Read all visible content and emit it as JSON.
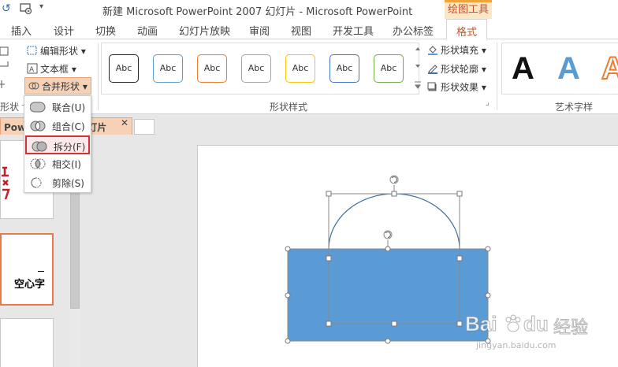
{
  "window": {
    "title": "新建 Microsoft PowerPoint 2007 幻灯片 - Microsoft PowerPoint",
    "context_tab_group": "绘图工具"
  },
  "tabs": [
    {
      "label": "插入"
    },
    {
      "label": "设计"
    },
    {
      "label": "切换"
    },
    {
      "label": "动画"
    },
    {
      "label": "幻灯片放映"
    },
    {
      "label": "审阅"
    },
    {
      "label": "视图"
    },
    {
      "label": "开发工具"
    },
    {
      "label": "办公标签"
    },
    {
      "label": "格式",
      "active": true
    }
  ],
  "ribbon": {
    "insert_shapes": {
      "edit_shape": "编辑形状",
      "text_box": "文本框",
      "merge_shapes": "合并形状",
      "group_label": "形状"
    },
    "shape_styles": {
      "group_label": "形状样式",
      "presets": [
        {
          "label": "Abc",
          "border": "#222222"
        },
        {
          "label": "Abc",
          "border": "#5b9bd5"
        },
        {
          "label": "Abc",
          "border": "#ed7d31"
        },
        {
          "label": "Abc",
          "border": "#a5a5a5"
        },
        {
          "label": "Abc",
          "border": "#ffc000"
        },
        {
          "label": "Abc",
          "border": "#4472c4"
        },
        {
          "label": "Abc",
          "border": "#70ad47"
        }
      ],
      "fill": "形状填充",
      "outline": "形状轮廓",
      "effects": "形状效果"
    },
    "wordart": {
      "group_label": "艺术字样",
      "letters": [
        {
          "char": "A",
          "color": "#111111"
        },
        {
          "char": "A",
          "color": "#5b9bd5"
        },
        {
          "char": "A",
          "color": "#ed7d31"
        }
      ]
    }
  },
  "merge_menu": {
    "items": [
      {
        "label": "联合(U)"
      },
      {
        "label": "组合(C)"
      },
      {
        "label": "拆分(F)",
        "highlighted": true
      },
      {
        "label": "相交(I)"
      },
      {
        "label": "剪除(S)"
      }
    ]
  },
  "doc_tab": {
    "label": "Powe",
    "label_tail": "幻灯片",
    "close": "✕"
  },
  "thumbnails": {
    "slide2_text": "空心字"
  },
  "colors": {
    "accent": "#c0562a",
    "rect_fill": "#5b9bd5",
    "rect_stroke": "#41719c",
    "highlight_border": "#d13438"
  },
  "watermark": {
    "brand": "Bai",
    "brand2": "du",
    "cn": "经验",
    "url": "jingyan.baidu.com"
  }
}
